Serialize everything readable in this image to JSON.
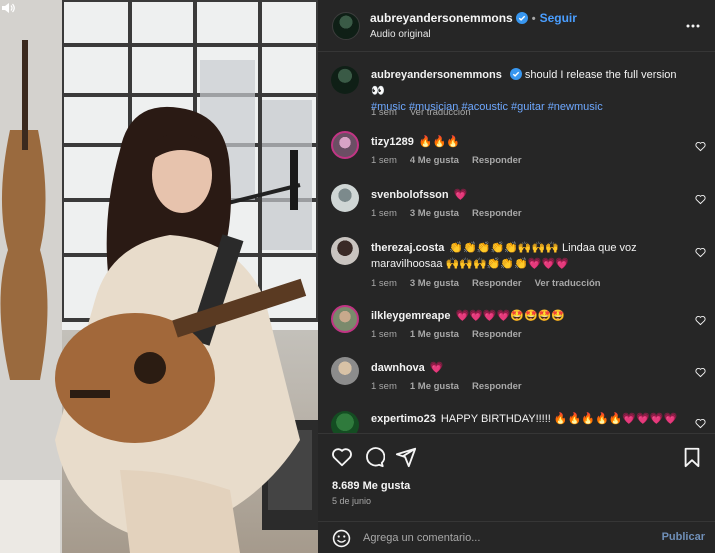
{
  "post": {
    "username": "aubreyandersonemmons",
    "follow_label": "Seguir",
    "separator": "•",
    "audio": "Audio original",
    "caption": {
      "text": "should I release the full version 👀",
      "hashtags": "#music #musician #acoustic #guitar #newmusic",
      "time": "1 sem",
      "translate": "Ver traducción"
    }
  },
  "comments": [
    {
      "user": "tizy1289",
      "text": "🔥🔥🔥",
      "time": "1 sem",
      "likes": "4 Me gusta",
      "reply": "Responder"
    },
    {
      "user": "svenbolofsson",
      "text": "💗",
      "time": "1 sem",
      "likes": "3 Me gusta",
      "reply": "Responder"
    },
    {
      "user": "therezaj.costa",
      "text": "👏👏👏👏👏🙌🙌🙌 Lindaa que voz maravilhoosaa 🙌🙌🙌👏👏👏💗💗💗",
      "time": "1 sem",
      "likes": "3 Me gusta",
      "reply": "Responder",
      "translate": "Ver traducción"
    },
    {
      "user": "ilkleygemreape",
      "text": "💗💗💗💗🤩🤩🤩🤩",
      "time": "1 sem",
      "likes": "1 Me gusta",
      "reply": "Responder"
    },
    {
      "user": "dawnhova",
      "text": "💗",
      "time": "1 sem",
      "likes": "1 Me gusta",
      "reply": "Responder"
    },
    {
      "user": "expertimo23",
      "text": "HAPPY BIRTHDAY!!!!! 🔥🔥🔥🔥🔥💗💗💗💗",
      "time": "",
      "likes": "",
      "reply": ""
    }
  ],
  "stats": {
    "likes": "8.689 Me gusta",
    "date": "5 de junio"
  },
  "composer": {
    "placeholder": "Agrega un comentario...",
    "publish_label": "Publicar"
  },
  "icons": {
    "verified": "verified-badge-icon",
    "more": "more-options-icon",
    "like": "heart-icon",
    "comment": "comment-icon",
    "share": "share-icon",
    "save": "bookmark-icon",
    "emoji": "emoji-icon",
    "audio": "speaker-icon"
  },
  "colors": {
    "accent": "#4a9eff",
    "panel": "#262626",
    "hashtag": "#6ea8ff",
    "verified": "#3897f0"
  }
}
